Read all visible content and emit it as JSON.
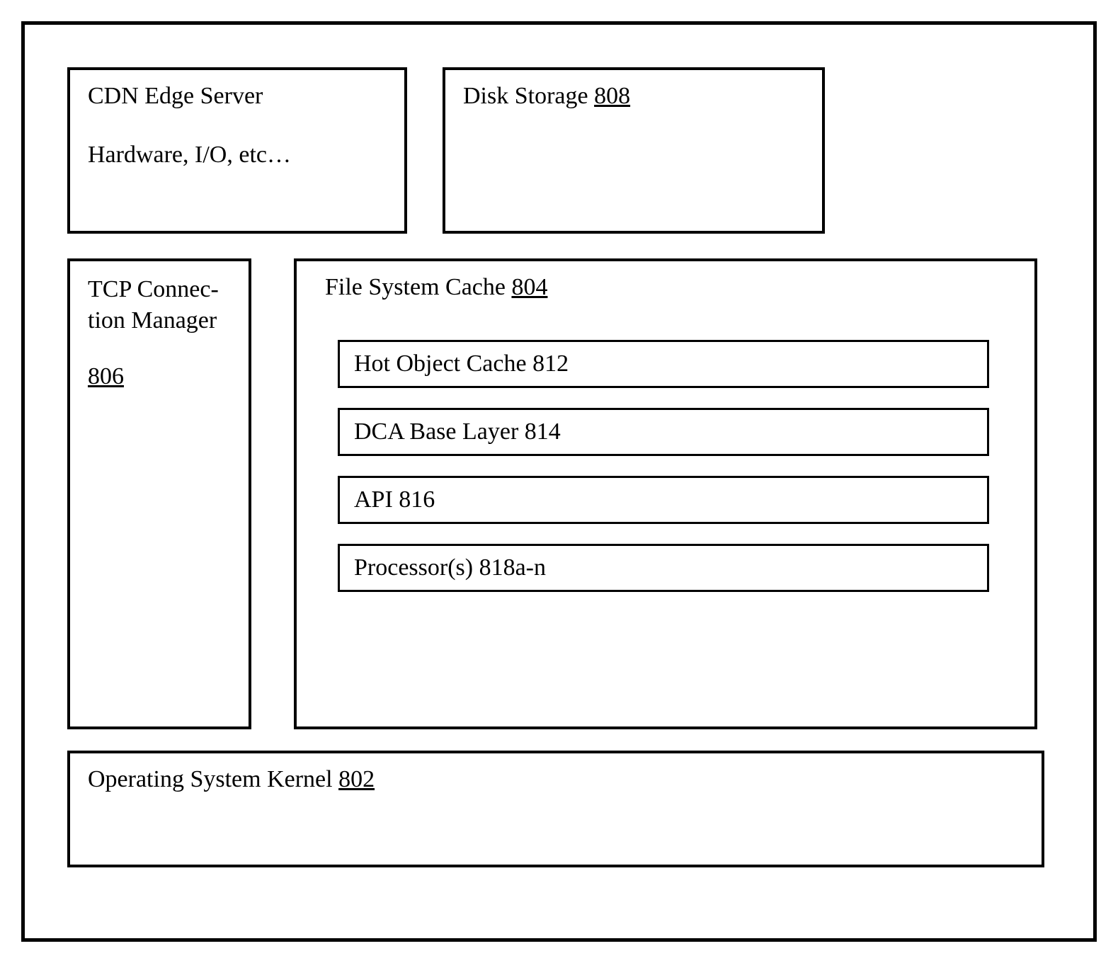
{
  "diagram": {
    "cdn": {
      "title": "CDN Edge Server",
      "subtitle": "Hardware, I/O, etc…"
    },
    "disk": {
      "label": "Disk Storage ",
      "ref": "808"
    },
    "tcp": {
      "label": "TCP Connec-tion Manager",
      "ref": "806"
    },
    "fsc": {
      "label": "File System Cache  ",
      "ref": "804",
      "items": [
        {
          "label": "Hot Object Cache  812"
        },
        {
          "label": "DCA Base Layer 814"
        },
        {
          "label": "API 816"
        },
        {
          "label": "Processor(s) 818a-n"
        }
      ]
    },
    "os": {
      "label": "Operating System Kernel ",
      "ref": "802"
    }
  }
}
